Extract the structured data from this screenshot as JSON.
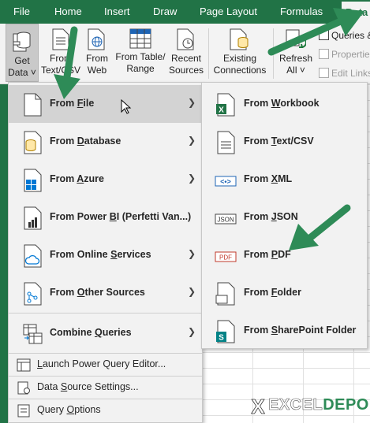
{
  "ribbon_tabs": [
    "File",
    "Home",
    "Insert",
    "Draw",
    "Page Layout",
    "Formulas",
    "Data"
  ],
  "active_tab": "Data",
  "ribbon": {
    "get_data": [
      "Get",
      "Data ˅"
    ],
    "from_text": [
      "From",
      "Text/CSV"
    ],
    "from_web": [
      "From",
      "Web"
    ],
    "from_table": [
      "From Table/",
      "Range"
    ],
    "recent_sources": [
      "Recent",
      "Sources"
    ],
    "existing_connections": [
      "Existing",
      "Connections"
    ],
    "refresh_all": [
      "Refresh",
      "All ˅"
    ],
    "queries": "Queries &",
    "properties": "Properties",
    "edit_links": "Edit Links"
  },
  "menu": {
    "items": [
      {
        "pre": "From ",
        "key": "F",
        "post": "ile",
        "icon": "file-icon"
      },
      {
        "pre": "From ",
        "key": "D",
        "post": "atabase",
        "icon": "database-icon"
      },
      {
        "pre": "From ",
        "key": "A",
        "post": "zure",
        "icon": "azure-icon"
      },
      {
        "pre": "From Power ",
        "key": "B",
        "post": "I (Perfetti Van...)",
        "icon": "power-bi-icon"
      },
      {
        "pre": "From Online ",
        "key": "S",
        "post": "ervices",
        "icon": "cloud-icon"
      },
      {
        "pre": "From ",
        "key": "O",
        "post": "ther Sources",
        "icon": "other-sources-icon"
      },
      {
        "pre": "Combine ",
        "key": "Q",
        "post": "ueries",
        "icon": "combine-queries-icon"
      }
    ],
    "small_items": [
      {
        "pre": "",
        "key": "L",
        "post": "aunch Power Query Editor...",
        "icon": "power-query-icon"
      },
      {
        "pre": "Data ",
        "key": "S",
        "post": "ource Settings...",
        "icon": "settings-icon"
      },
      {
        "pre": "Query ",
        "key": "O",
        "post": "ptions",
        "icon": "options-icon"
      }
    ]
  },
  "submenu": {
    "items": [
      {
        "pre": "From ",
        "key": "W",
        "post": "orkbook",
        "icon": "excel-workbook-icon"
      },
      {
        "pre": "From ",
        "key": "T",
        "post": "ext/CSV",
        "icon": "text-file-icon"
      },
      {
        "pre": "From ",
        "key": "X",
        "post": "ML",
        "icon": "xml-icon"
      },
      {
        "pre": "From ",
        "key": "J",
        "post": "SON",
        "icon": "json-icon"
      },
      {
        "pre": "From ",
        "key": "P",
        "post": "DF",
        "icon": "pdf-icon"
      },
      {
        "pre": "From ",
        "key": "F",
        "post": "older",
        "icon": "folder-icon"
      },
      {
        "pre": "From ",
        "key": "S",
        "post": "harePoint Folder",
        "icon": "sharepoint-icon"
      }
    ]
  },
  "icon_labels": {
    "xml": "<•>",
    "json": "JSON",
    "pdf": "PDF",
    "excel": "X",
    "sharepoint": "S"
  },
  "logo": {
    "x_mark": "X",
    "brand_main": "EXCEL",
    "brand_accent": "DEPO"
  },
  "colors": {
    "excel_green": "#217346",
    "arrow_green": "#2e8b57",
    "highlight": "#d3d3d3",
    "menu_bg": "#f2f2f2"
  }
}
